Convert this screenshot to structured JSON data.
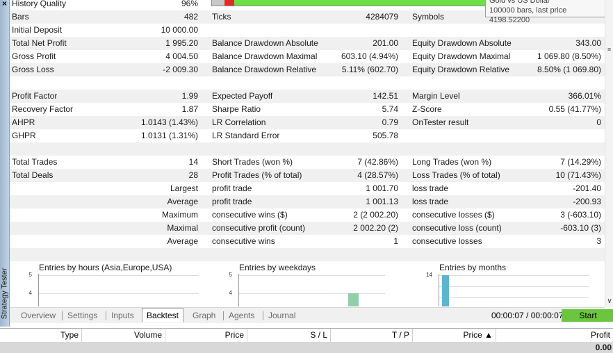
{
  "window": {
    "side_title": "Strategy Tester",
    "close_glyph": "×"
  },
  "tooltip": {
    "line1": "Gold vs US Dollar",
    "line2": "100000 bars, last price 4198.52200"
  },
  "report": {
    "history_quality": {
      "label": "History Quality",
      "value": "96%"
    },
    "rows": [
      {
        "c1l": "Bars",
        "c1v": "482",
        "c2l": "Ticks",
        "c2v": "4284079",
        "c3l": "Symbols",
        "c3v": ""
      },
      {
        "c1l": "Initial Deposit",
        "c1v": "10 000.00",
        "c2l": "",
        "c2v": "",
        "c3l": "",
        "c3v": ""
      },
      {
        "c1l": "Total Net Profit",
        "c1v": "1 995.20",
        "c2l": "Balance Drawdown Absolute",
        "c2v": "201.00",
        "c3l": "Equity Drawdown Absolute",
        "c3v": "343.00"
      },
      {
        "c1l": "Gross Profit",
        "c1v": "4 004.50",
        "c2l": "Balance Drawdown Maximal",
        "c2v": "603.10 (4.94%)",
        "c3l": "Equity Drawdown Maximal",
        "c3v": "1 069.80 (8.50%)"
      },
      {
        "c1l": "Gross Loss",
        "c1v": "-2 009.30",
        "c2l": "Balance Drawdown Relative",
        "c2v": "5.11% (602.70)",
        "c3l": "Equity Drawdown Relative",
        "c3v": "8.50% (1 069.80)"
      },
      {
        "c1l": "",
        "c1v": "",
        "c2l": "",
        "c2v": "",
        "c3l": "",
        "c3v": ""
      },
      {
        "c1l": "Profit Factor",
        "c1v": "1.99",
        "c2l": "Expected Payoff",
        "c2v": "142.51",
        "c3l": "Margin Level",
        "c3v": "366.01%"
      },
      {
        "c1l": "Recovery Factor",
        "c1v": "1.87",
        "c2l": "Sharpe Ratio",
        "c2v": "5.74",
        "c3l": "Z-Score",
        "c3v": "0.55 (41.77%)"
      },
      {
        "c1l": "AHPR",
        "c1v": "1.0143 (1.43%)",
        "c2l": "LR Correlation",
        "c2v": "0.79",
        "c3l": "OnTester result",
        "c3v": "0"
      },
      {
        "c1l": "GHPR",
        "c1v": "1.0131 (1.31%)",
        "c2l": "LR Standard Error",
        "c2v": "505.78",
        "c3l": "",
        "c3v": ""
      },
      {
        "c1l": "",
        "c1v": "",
        "c2l": "",
        "c2v": "",
        "c3l": "",
        "c3v": ""
      },
      {
        "c1l": "Total Trades",
        "c1v": "14",
        "c2l": "Short Trades (won %)",
        "c2v": "7 (42.86%)",
        "c3l": "Long Trades (won %)",
        "c3v": "7 (14.29%)"
      },
      {
        "c1l": "Total Deals",
        "c1v": "28",
        "c2l": "Profit Trades (% of total)",
        "c2v": "4 (28.57%)",
        "c3l": "Loss Trades (% of total)",
        "c3v": "10 (71.43%)"
      }
    ],
    "right_rows": [
      {
        "c1r": "Largest",
        "c2l": "profit trade",
        "c2v": "1 001.70",
        "c3l": "loss trade",
        "c3v": "-201.40"
      },
      {
        "c1r": "Average",
        "c2l": "profit trade",
        "c2v": "1 001.13",
        "c3l": "loss trade",
        "c3v": "-200.93"
      },
      {
        "c1r": "Maximum",
        "c2l": "consecutive wins ($)",
        "c2v": "2 (2 002.20)",
        "c3l": "consecutive losses ($)",
        "c3v": "3 (-603.10)"
      },
      {
        "c1r": "Maximal",
        "c2l": "consecutive profit (count)",
        "c2v": "2 002.20 (2)",
        "c3l": "consecutive loss (count)",
        "c3v": "-603.10 (3)"
      },
      {
        "c1r": "Average",
        "c2l": "consecutive wins",
        "c2v": "1",
        "c3l": "consecutive losses",
        "c3v": "3"
      }
    ]
  },
  "charts": [
    {
      "title": "Entries by hours (Asia,Europe,USA)",
      "ticks": [
        "5",
        "4"
      ]
    },
    {
      "title": "Entries by weekdays",
      "ticks": [
        "5",
        "4"
      ]
    },
    {
      "title": "Entries by months",
      "ticks": [
        "14"
      ]
    }
  ],
  "chart_data": [
    {
      "type": "bar",
      "title": "Entries by hours (Asia,Europe,USA)",
      "ylim": [
        0,
        5
      ]
    },
    {
      "type": "bar",
      "title": "Entries by weekdays",
      "ylim": [
        0,
        5
      ]
    },
    {
      "type": "bar",
      "title": "Entries by months",
      "ylim": [
        0,
        14
      ]
    }
  ],
  "colors": {
    "accent_green": "#6bc53e",
    "quality_green": "#6ee046",
    "quality_red": "#e8292a",
    "bar_weekday": "#90d0a8",
    "bar_month": "#5fb4d4"
  },
  "tabs": [
    "Overview",
    "Settings",
    "Inputs",
    "Backtest",
    "Graph",
    "Agents",
    "Journal"
  ],
  "timer": "00:00:07 / 00:00:07",
  "start_label": "Start",
  "deal_table": {
    "columns": [
      "Type",
      "Volume",
      "Price",
      "S / L",
      "T / P",
      "Price ▲",
      "Profit"
    ],
    "total_profit": "0.00"
  }
}
